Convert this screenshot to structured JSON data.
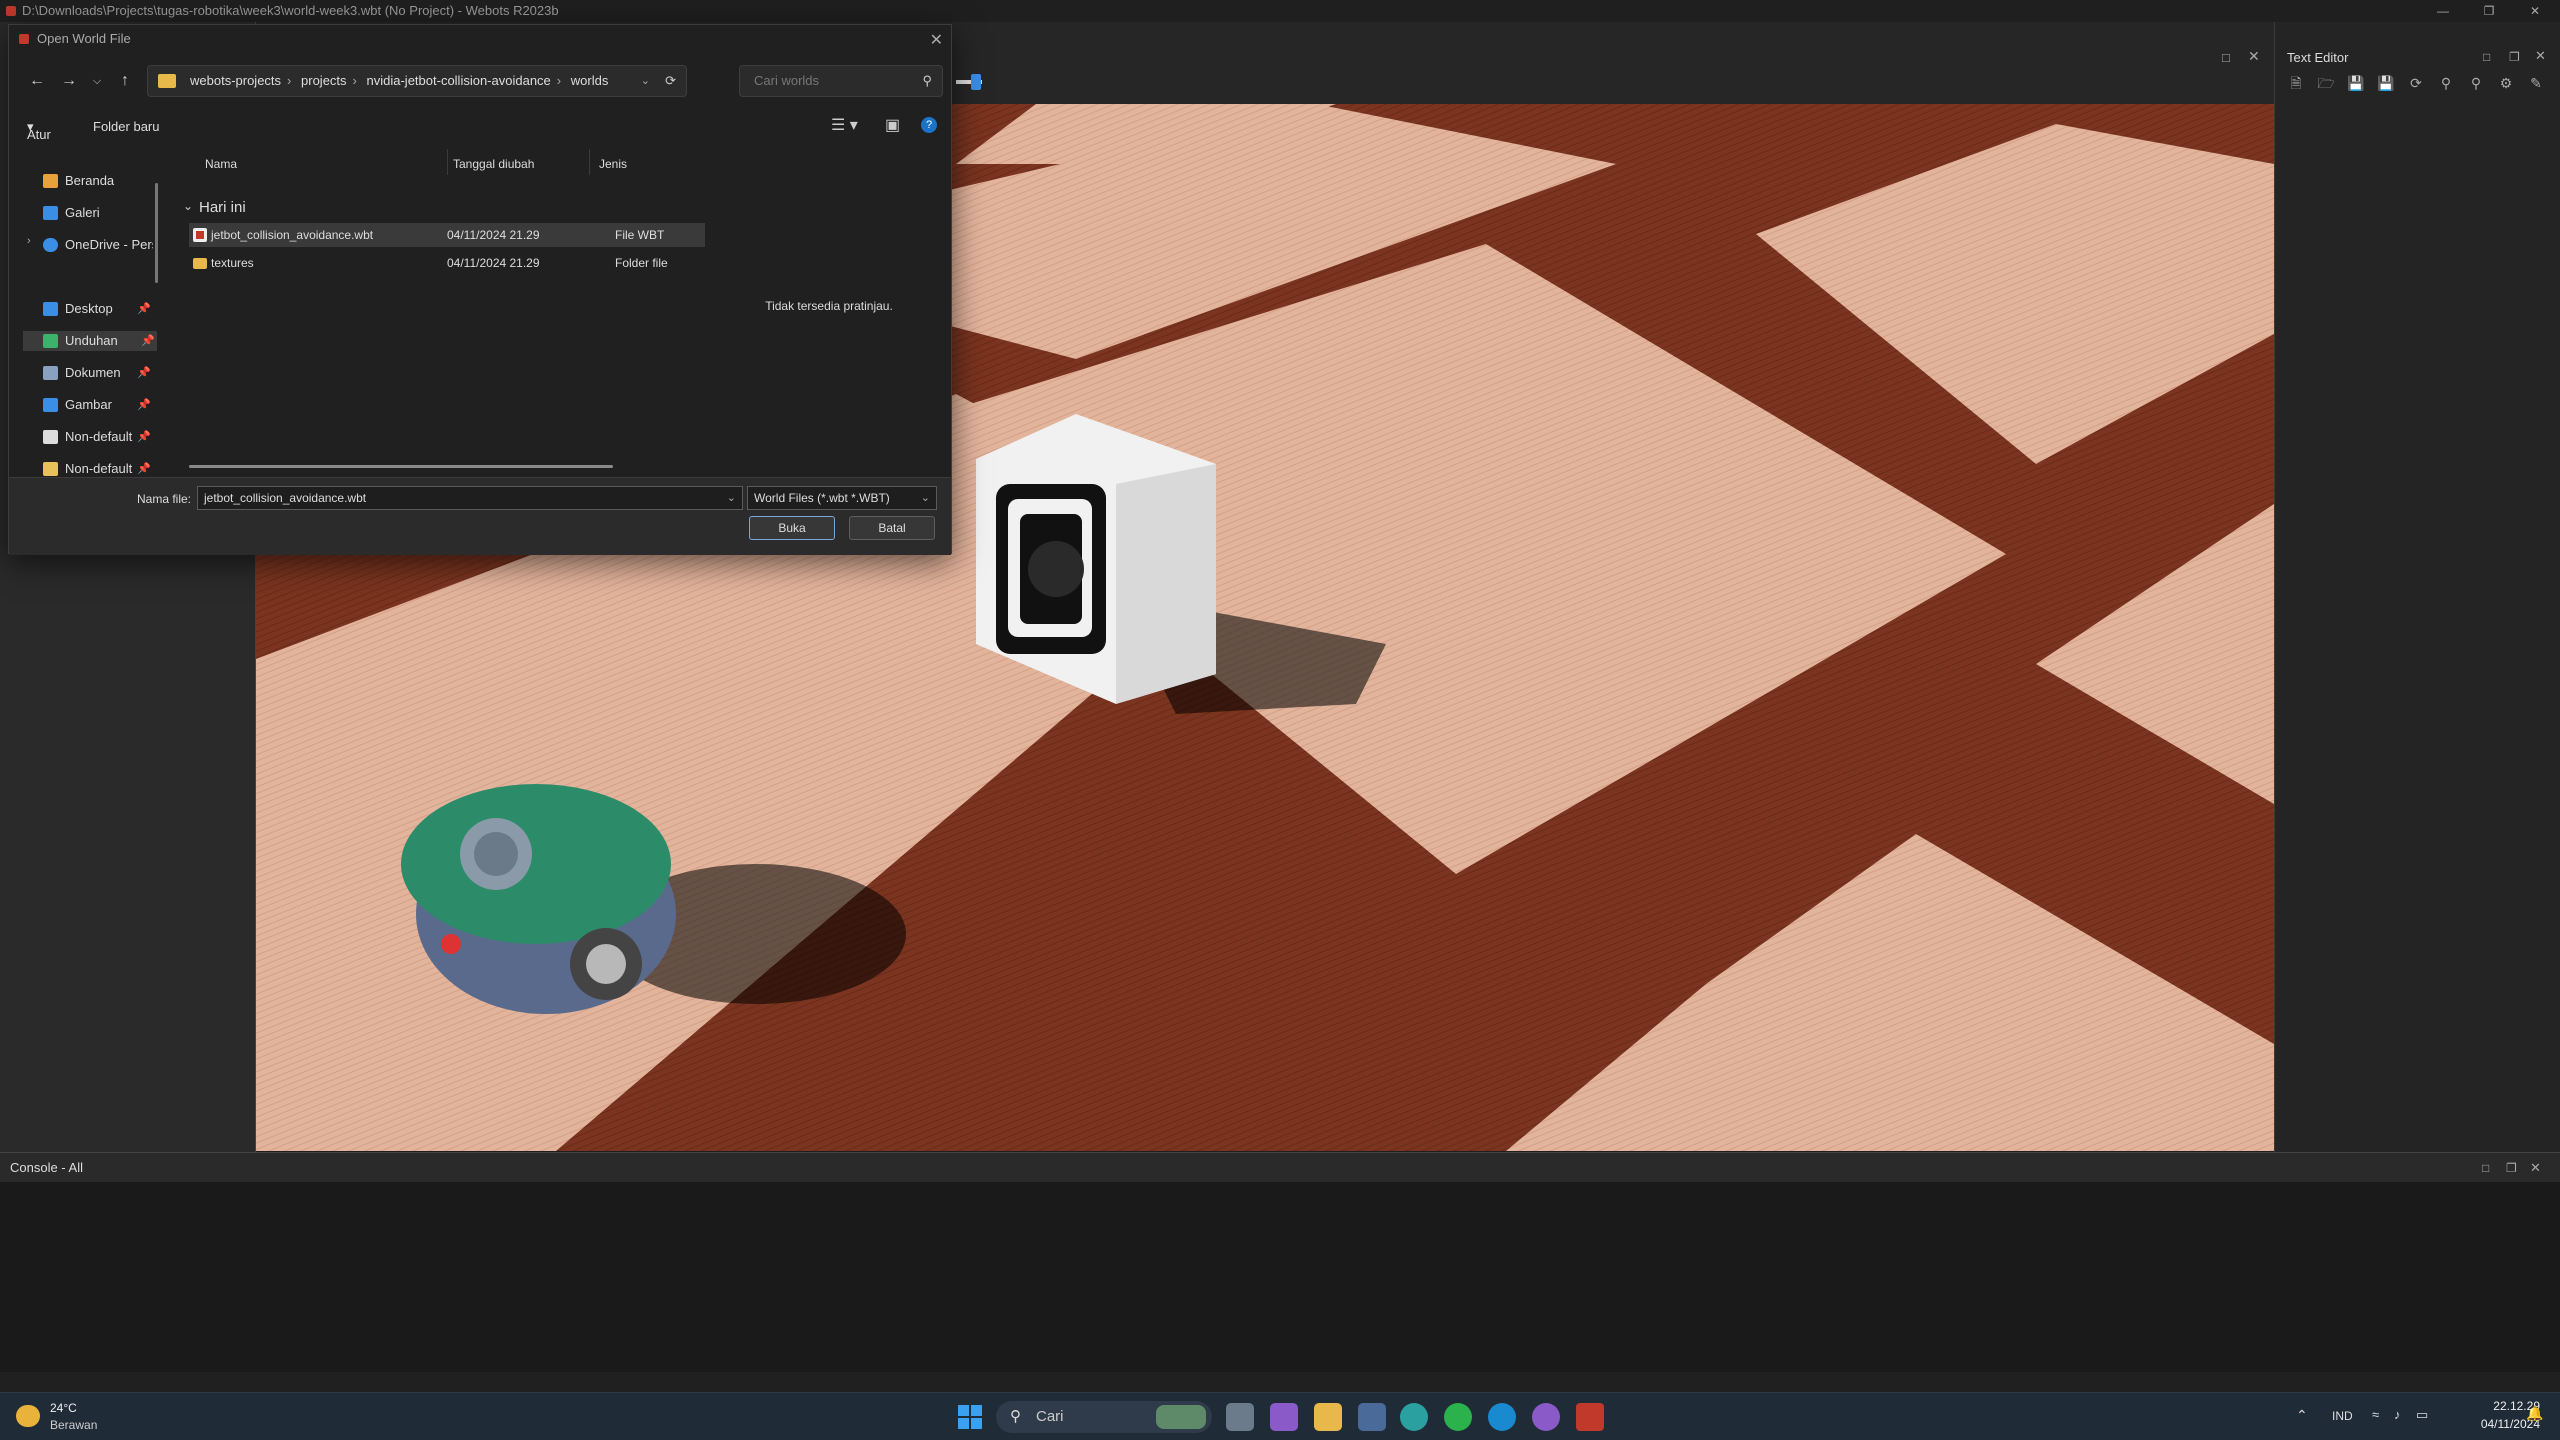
{
  "window": {
    "title": "D:\\Downloads\\Projects\\tugas-robotika\\week3\\world-week3.wbt (No Project) - Webots R2023b"
  },
  "text_editor": {
    "title": "Text Editor"
  },
  "console": {
    "title": "Console - All"
  },
  "dialog": {
    "title": "Open World File",
    "breadcrumbs": [
      "webots-projects",
      "projects",
      "nvidia-jetbot-collision-avoidance",
      "worlds"
    ],
    "search_placeholder": "Cari worlds",
    "organize_label": "Atur",
    "new_folder_label": "Folder baru",
    "nav_items": [
      {
        "label": "Beranda",
        "icon": "home-icon",
        "color": "#e9a23b"
      },
      {
        "label": "Galeri",
        "icon": "gallery-icon",
        "color": "#3a8ee6"
      },
      {
        "label": "OneDrive - Perso",
        "icon": "cloud-icon",
        "color": "#3a8ee6"
      },
      {
        "label": "Desktop",
        "icon": "desktop-icon",
        "color": "#3a8ee6"
      },
      {
        "label": "Unduhan",
        "icon": "download-icon",
        "color": "#3bb36b"
      },
      {
        "label": "Dokumen",
        "icon": "document-icon",
        "color": "#8aa0c0"
      },
      {
        "label": "Gambar",
        "icon": "picture-icon",
        "color": "#3a8ee6"
      },
      {
        "label": "Non-default",
        "icon": "file-icon",
        "color": "#dddddd"
      },
      {
        "label": "Non-default",
        "icon": "file-icon",
        "color": "#e8c15a"
      }
    ],
    "columns": [
      "Nama",
      "Tanggal diubah",
      "Jenis"
    ],
    "group_label": "Hari ini",
    "files": [
      {
        "name": "jetbot_collision_avoidance.wbt",
        "date": "04/11/2024 21.29",
        "type": "File WBT",
        "icon": "wbt-file-icon"
      },
      {
        "name": "textures",
        "date": "04/11/2024 21.29",
        "type": "Folder file",
        "icon": "folder-icon"
      }
    ],
    "preview_text": "Tidak tersedia pratinjau.",
    "filename_label": "Nama file:",
    "filename_value": "jetbot_collision_avoidance.wbt",
    "filter_value": "World Files (*.wbt *.WBT)",
    "open_label": "Buka",
    "cancel_label": "Batal"
  },
  "taskbar": {
    "weather_temp": "24°C",
    "weather_desc": "Berawan",
    "search_label": "Cari",
    "language": "IND",
    "time": "22.12.29",
    "date": "04/11/2024"
  }
}
